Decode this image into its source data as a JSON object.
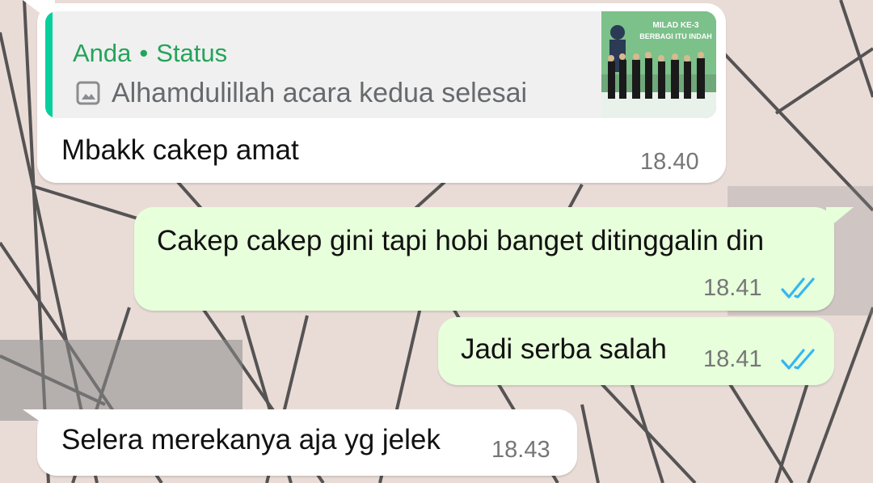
{
  "colors": {
    "incoming_bubble": "#ffffff",
    "outgoing_bubble": "#e7ffdb",
    "quote_accent": "#06cf9c",
    "read_ticks": "#34b7f1",
    "wallpaper": "#e9dcd7"
  },
  "messages": [
    {
      "direction": "incoming",
      "quote": {
        "author": "Anda",
        "separator": "•",
        "source": "Status",
        "icon": "image-icon",
        "text": "Alhamdulillah acara kedua selesai",
        "thumbnail_text": [
          "MILAD KE-3",
          "BERBAGI ITU INDAH"
        ]
      },
      "text": "Mbakk cakep amat",
      "time": "18.40"
    },
    {
      "direction": "outgoing",
      "text": "Cakep cakep gini tapi hobi banget ditinggalin din",
      "time": "18.41",
      "status": "read",
      "status_icon": "double-check-icon"
    },
    {
      "direction": "outgoing",
      "text": "Jadi serba salah",
      "time": "18.41",
      "status": "read",
      "status_icon": "double-check-icon"
    },
    {
      "direction": "incoming",
      "text": "Selera merekanya aja yg jelek",
      "time": "18.43"
    }
  ]
}
